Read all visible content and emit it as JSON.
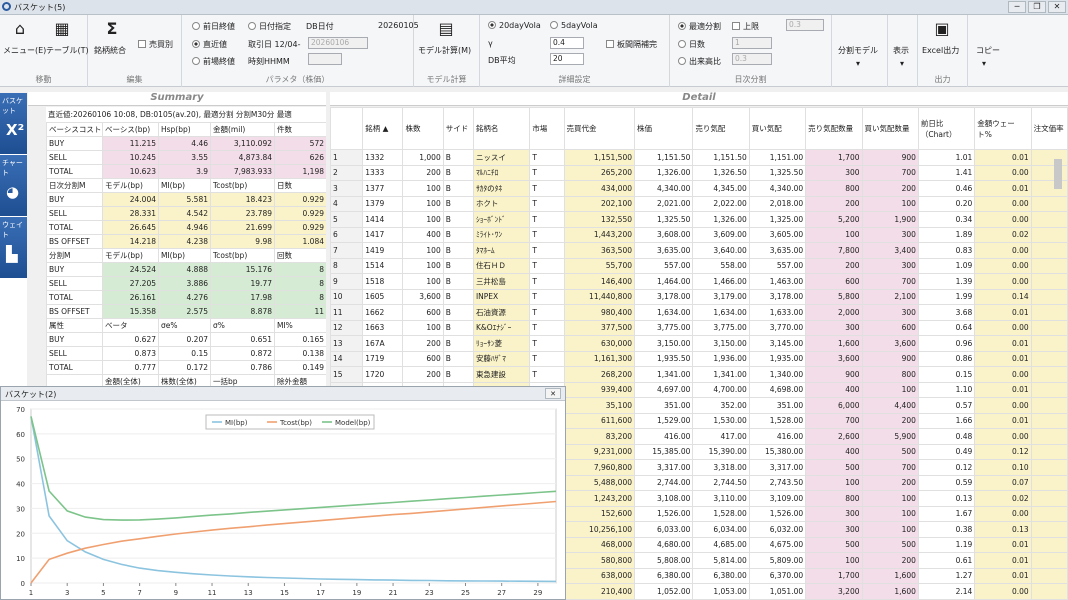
{
  "window": {
    "title": "バスケット(5)",
    "min": "─",
    "restore": "❐",
    "close": "✕"
  },
  "ribbon": {
    "g_move": {
      "label": "移動",
      "menu": "メニュー(E)",
      "table": "テーブル(T)"
    },
    "g_edit": {
      "label": "編集",
      "merge": "銘柄統合",
      "short": "売買別"
    },
    "g_param": {
      "label": "パラメタ（株価）",
      "prev_close": "前日終値",
      "date_spec": "日付指定",
      "db_date_label": "DB日付",
      "db_date": "20260105",
      "recent": "直近値",
      "fetch_date": "取引日 12/04-",
      "fetch_value": "20260106",
      "prev_open": "前場終値",
      "time_hhmm": "時刻HHMM"
    },
    "g_model": {
      "label": "モデル計算",
      "calc": "モデル計算(M)"
    },
    "g_detail": {
      "label": "詳細設定",
      "vola20": "20dayVola",
      "vola5": "5dayVola",
      "gamma_label": "γ",
      "gamma": "0.4",
      "dbavg_label": "DB平均",
      "dbavg": "20",
      "board": "板間隔補完"
    },
    "g_daily": {
      "label": "日次分割",
      "optimal": "最適分割",
      "upper": "上限",
      "upper_val": "0.3",
      "days": "日数",
      "days_val": "1",
      "volratio": "出来高比",
      "vol_val": "0.3"
    },
    "g_out": {
      "label": "出力",
      "model": "分割モデル",
      "show": "表示",
      "excel": "Excel出力",
      "copy": "コピー"
    }
  },
  "nav": {
    "basket": "バスケット",
    "chart": "チャート",
    "weight": "ウェイト"
  },
  "summary": {
    "title": "Summary",
    "info": "直近値:20260106 10:08, DB:0105(av.20), 最適分割 分割M30分 最適",
    "sections": [
      {
        "h": [
          "ベーシスコスト",
          "ベーシス(bp)",
          "Hsp(bp)",
          "金額(mil)",
          "件数"
        ],
        "c": "pink",
        "rows": [
          [
            "BUY",
            "11.215",
            "4.46",
            "3,110.092",
            "572"
          ],
          [
            "SELL",
            "10.245",
            "3.55",
            "4,873.84",
            "626"
          ],
          [
            "TOTAL",
            "10.623",
            "3.9",
            "7,983.933",
            "1,198"
          ]
        ]
      },
      {
        "h": [
          "日次分割M",
          "モデル(bp)",
          "MI(bp)",
          "Tcost(bp)",
          "日数"
        ],
        "c": "yel",
        "rows": [
          [
            "BUY",
            "24.004",
            "5.581",
            "18.423",
            "0.929"
          ],
          [
            "SELL",
            "28.331",
            "4.542",
            "23.789",
            "0.929"
          ],
          [
            "TOTAL",
            "26.645",
            "4.946",
            "21.699",
            "0.929"
          ],
          [
            "BS OFFSET",
            "14.218",
            "4.238",
            "9.98",
            "1.084"
          ]
        ]
      },
      {
        "h": [
          "分割M",
          "モデル(bp)",
          "MI(bp)",
          "Tcost(bp)",
          "回数"
        ],
        "c": "grn",
        "rows": [
          [
            "BUY",
            "24.524",
            "4.888",
            "15.176",
            "8"
          ],
          [
            "SELL",
            "27.205",
            "3.886",
            "19.77",
            "8"
          ],
          [
            "TOTAL",
            "26.161",
            "4.276",
            "17.98",
            "8"
          ],
          [
            "BS OFFSET",
            "15.358",
            "2.575",
            "8.878",
            "11"
          ]
        ]
      },
      {
        "h": [
          "属性",
          "ベータ",
          "σe%",
          "σ%",
          "MI%"
        ],
        "c": "",
        "rows": [
          [
            "BUY",
            "0.627",
            "0.207",
            "0.651",
            "0.165"
          ],
          [
            "SELL",
            "0.873",
            "0.15",
            "0.872",
            "0.138"
          ],
          [
            "TOTAL",
            "0.777",
            "0.172",
            "0.786",
            "0.149"
          ]
        ]
      },
      {
        "h": [
          "",
          "金額(全体)",
          "株数(全体)",
          "一括bp",
          "除外金額"
        ],
        "c": "",
        "rows": []
      }
    ]
  },
  "detail": {
    "title": "Detail",
    "headers": [
      "",
      "銘柄 ▲",
      "株数",
      "サイド",
      "銘柄名",
      "市場",
      "売買代金",
      "株価",
      "売り気配",
      "買い気配",
      "売り気配数量",
      "買い気配数量",
      "前日比（Chart）",
      "金額ウェート%",
      "注文価率"
    ],
    "rows": [
      [
        "1",
        "1332",
        "1,000",
        "B",
        "ニッスイ",
        "T",
        "1,151,500",
        "1,151.50",
        "1,151.50",
        "1,151.00",
        "1,700",
        "900",
        "1.01",
        "0.01"
      ],
      [
        "2",
        "1333",
        "200",
        "B",
        "ﾏﾙﾊﾆﾁﾛ",
        "T",
        "265,200",
        "1,326.00",
        "1,326.50",
        "1,325.50",
        "300",
        "700",
        "1.41",
        "0.00"
      ],
      [
        "3",
        "1377",
        "100",
        "B",
        "ｻｶﾀのﾀﾈ",
        "T",
        "434,000",
        "4,340.00",
        "4,345.00",
        "4,340.00",
        "800",
        "200",
        "0.46",
        "0.01"
      ],
      [
        "4",
        "1379",
        "100",
        "B",
        "ホクト",
        "T",
        "202,100",
        "2,021.00",
        "2,022.00",
        "2,018.00",
        "200",
        "100",
        "0.20",
        "0.00"
      ],
      [
        "5",
        "1414",
        "100",
        "B",
        "ｼｮｰﾎﾞﾝﾄﾞ",
        "T",
        "132,550",
        "1,325.50",
        "1,326.00",
        "1,325.00",
        "5,200",
        "1,900",
        "0.34",
        "0.00"
      ],
      [
        "6",
        "1417",
        "400",
        "B",
        "ﾐﾗｲﾄ･ﾜﾝ",
        "T",
        "1,443,200",
        "3,608.00",
        "3,609.00",
        "3,605.00",
        "100",
        "300",
        "1.89",
        "0.02"
      ],
      [
        "7",
        "1419",
        "100",
        "B",
        "ﾀﾏﾎｰﾑ",
        "T",
        "363,500",
        "3,635.00",
        "3,640.00",
        "3,635.00",
        "7,800",
        "3,400",
        "0.83",
        "0.00"
      ],
      [
        "8",
        "1514",
        "100",
        "B",
        "住石ＨＤ",
        "T",
        "55,700",
        "557.00",
        "558.00",
        "557.00",
        "200",
        "300",
        "1.09",
        "0.00"
      ],
      [
        "9",
        "1518",
        "100",
        "B",
        "三井松島",
        "T",
        "146,400",
        "1,464.00",
        "1,466.00",
        "1,463.00",
        "600",
        "700",
        "1.39",
        "0.00"
      ],
      [
        "10",
        "1605",
        "3,600",
        "B",
        "INPEX",
        "T",
        "11,440,800",
        "3,178.00",
        "3,179.00",
        "3,178.00",
        "5,800",
        "2,100",
        "1.99",
        "0.14"
      ],
      [
        "11",
        "1662",
        "600",
        "B",
        "石油資源",
        "T",
        "980,400",
        "1,634.00",
        "1,634.00",
        "1,633.00",
        "2,000",
        "300",
        "3.68",
        "0.01"
      ],
      [
        "12",
        "1663",
        "100",
        "B",
        "K&Oｴﾅｼﾞｰ",
        "T",
        "377,500",
        "3,775.00",
        "3,775.00",
        "3,770.00",
        "300",
        "600",
        "0.64",
        "0.00"
      ],
      [
        "13",
        "167A",
        "200",
        "B",
        "ﾘｮｰｻﾝ菱",
        "T",
        "630,000",
        "3,150.00",
        "3,150.00",
        "3,145.00",
        "1,600",
        "3,600",
        "0.96",
        "0.01"
      ],
      [
        "14",
        "1719",
        "600",
        "B",
        "安藤ﾊｻﾞﾏ",
        "T",
        "1,161,300",
        "1,935.50",
        "1,936.00",
        "1,935.00",
        "3,600",
        "900",
        "0.86",
        "0.01"
      ],
      [
        "15",
        "1720",
        "200",
        "B",
        "東急建設",
        "T",
        "268,200",
        "1,341.00",
        "1,341.00",
        "1,340.00",
        "900",
        "800",
        "0.15",
        "0.00"
      ],
      [
        "",
        "",
        "",
        "",
        "",
        "",
        "939,400",
        "4,697.00",
        "4,700.00",
        "4,698.00",
        "400",
        "100",
        "1.10",
        "0.01"
      ],
      [
        "",
        "",
        "",
        "",
        "",
        "",
        "35,100",
        "351.00",
        "352.00",
        "351.00",
        "6,000",
        "4,400",
        "0.57",
        "0.00"
      ],
      [
        "",
        "",
        "",
        "",
        "",
        "",
        "611,600",
        "1,529.00",
        "1,530.00",
        "1,528.00",
        "700",
        "200",
        "1.66",
        "0.01"
      ],
      [
        "",
        "",
        "",
        "",
        "",
        "",
        "83,200",
        "416.00",
        "417.00",
        "416.00",
        "2,600",
        "5,900",
        "0.48",
        "0.00"
      ],
      [
        "",
        "",
        "",
        "",
        "",
        "",
        "9,231,000",
        "15,385.00",
        "15,390.00",
        "15,380.00",
        "400",
        "500",
        "0.49",
        "0.12"
      ],
      [
        "",
        "",
        "",
        "",
        "",
        "",
        "7,960,800",
        "3,317.00",
        "3,318.00",
        "3,317.00",
        "500",
        "700",
        "0.12",
        "0.10"
      ],
      [
        "",
        "",
        "",
        "",
        "",
        "",
        "5,488,000",
        "2,744.00",
        "2,744.50",
        "2,743.50",
        "100",
        "200",
        "0.59",
        "0.07"
      ],
      [
        "",
        "",
        "",
        "",
        "",
        "",
        "1,243,200",
        "3,108.00",
        "3,110.00",
        "3,109.00",
        "800",
        "100",
        "0.13",
        "0.02"
      ],
      [
        "",
        "",
        "",
        "",
        "",
        "",
        "152,600",
        "1,526.00",
        "1,528.00",
        "1,526.00",
        "300",
        "100",
        "1.67",
        "0.00"
      ],
      [
        "",
        "",
        "",
        "",
        "",
        "",
        "10,256,100",
        "6,033.00",
        "6,034.00",
        "6,032.00",
        "300",
        "100",
        "0.38",
        "0.13"
      ],
      [
        "",
        "",
        "",
        "",
        "",
        "",
        "468,000",
        "4,680.00",
        "4,685.00",
        "4,675.00",
        "500",
        "500",
        "1.19",
        "0.01"
      ],
      [
        "",
        "",
        "",
        "",
        "",
        "",
        "580,800",
        "5,808.00",
        "5,814.00",
        "5,809.00",
        "100",
        "200",
        "0.61",
        "0.01"
      ],
      [
        "",
        "",
        "",
        "",
        "",
        "",
        "638,000",
        "6,380.00",
        "6,380.00",
        "6,370.00",
        "1,700",
        "1,600",
        "1.27",
        "0.01"
      ],
      [
        "",
        "",
        "",
        "",
        "",
        "",
        "210,400",
        "1,052.00",
        "1,053.00",
        "1,051.00",
        "3,200",
        "1,600",
        "2.14",
        "0.00"
      ]
    ]
  },
  "popup": {
    "title": "バスケット(2)",
    "close": "✕"
  },
  "chart_data": {
    "type": "line",
    "legend": "top-center",
    "x": [
      1,
      2,
      3,
      4,
      5,
      6,
      7,
      8,
      9,
      10,
      11,
      12,
      13,
      14,
      15,
      16,
      17,
      18,
      19,
      20,
      21,
      22,
      23,
      24,
      25,
      26,
      27,
      28,
      29,
      30
    ],
    "xticks": [
      1,
      3,
      5,
      7,
      9,
      11,
      13,
      15,
      17,
      19,
      21,
      23,
      25,
      27,
      29
    ],
    "ylim": [
      0,
      70
    ],
    "yticks": [
      0,
      10,
      20,
      30,
      40,
      50,
      60,
      70
    ],
    "series": [
      {
        "name": "MI(bp)",
        "color": "#8cc4e0",
        "values": [
          67,
          27,
          17,
          12.5,
          9.5,
          7.5,
          6,
          5,
          4.3,
          3.7,
          3.2,
          2.8,
          2.5,
          2.2,
          2.0,
          1.8,
          1.6,
          1.5,
          1.35,
          1.25,
          1.15,
          1.05,
          1.0,
          0.9,
          0.85,
          0.8,
          0.75,
          0.72,
          0.68,
          0.65
        ]
      },
      {
        "name": "Tcost(bp)",
        "color": "#f0a070",
        "values": [
          0,
          9.5,
          12,
          14,
          15.5,
          16.8,
          17.8,
          18.8,
          19.7,
          20.5,
          21.3,
          22.0,
          22.6,
          23.3,
          23.9,
          24.5,
          25.1,
          25.7,
          26.3,
          26.9,
          27.5,
          28.0,
          28.6,
          29.2,
          29.8,
          30.4,
          31.0,
          31.6,
          32.2,
          32.8
        ]
      },
      {
        "name": "Model(bp)",
        "color": "#7cc48a",
        "values": [
          67,
          37,
          29,
          26.5,
          25.5,
          25.3,
          25.4,
          25.7,
          26.2,
          26.8,
          27.3,
          27.8,
          28.4,
          28.9,
          29.4,
          29.9,
          30.4,
          30.9,
          31.4,
          31.9,
          32.4,
          32.9,
          33.4,
          33.9,
          34.4,
          34.9,
          35.4,
          35.9,
          36.4,
          36.9
        ]
      }
    ]
  }
}
